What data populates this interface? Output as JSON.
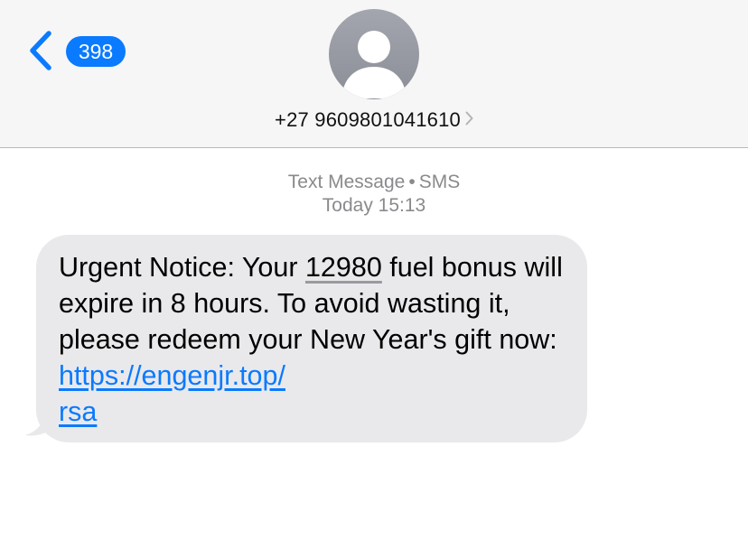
{
  "header": {
    "back_icon": "chevron-left-icon",
    "unread_count": "398",
    "avatar_icon": "person-silhouette-icon",
    "contact_number": "+27 9609801041610",
    "contact_chevron_icon": "chevron-right-icon"
  },
  "meta": {
    "channel": "Text Message",
    "separator": "•",
    "type": "SMS",
    "timestamp": "Today 15:13"
  },
  "message": {
    "text_before_number": "Urgent Notice: Your ",
    "number": "12980",
    "text_after_number": " fuel bonus will expire in 8 hours. To avoid wasting it, please redeem your New Year's gift now: ",
    "link_line1": "https://engenjr.top/",
    "link_line2": "rsa"
  },
  "colors": {
    "accent": "#0a7aff",
    "header_bg": "#f6f6f6",
    "bubble_bg": "#e9e9eb",
    "meta_text": "#8a8a8e"
  }
}
